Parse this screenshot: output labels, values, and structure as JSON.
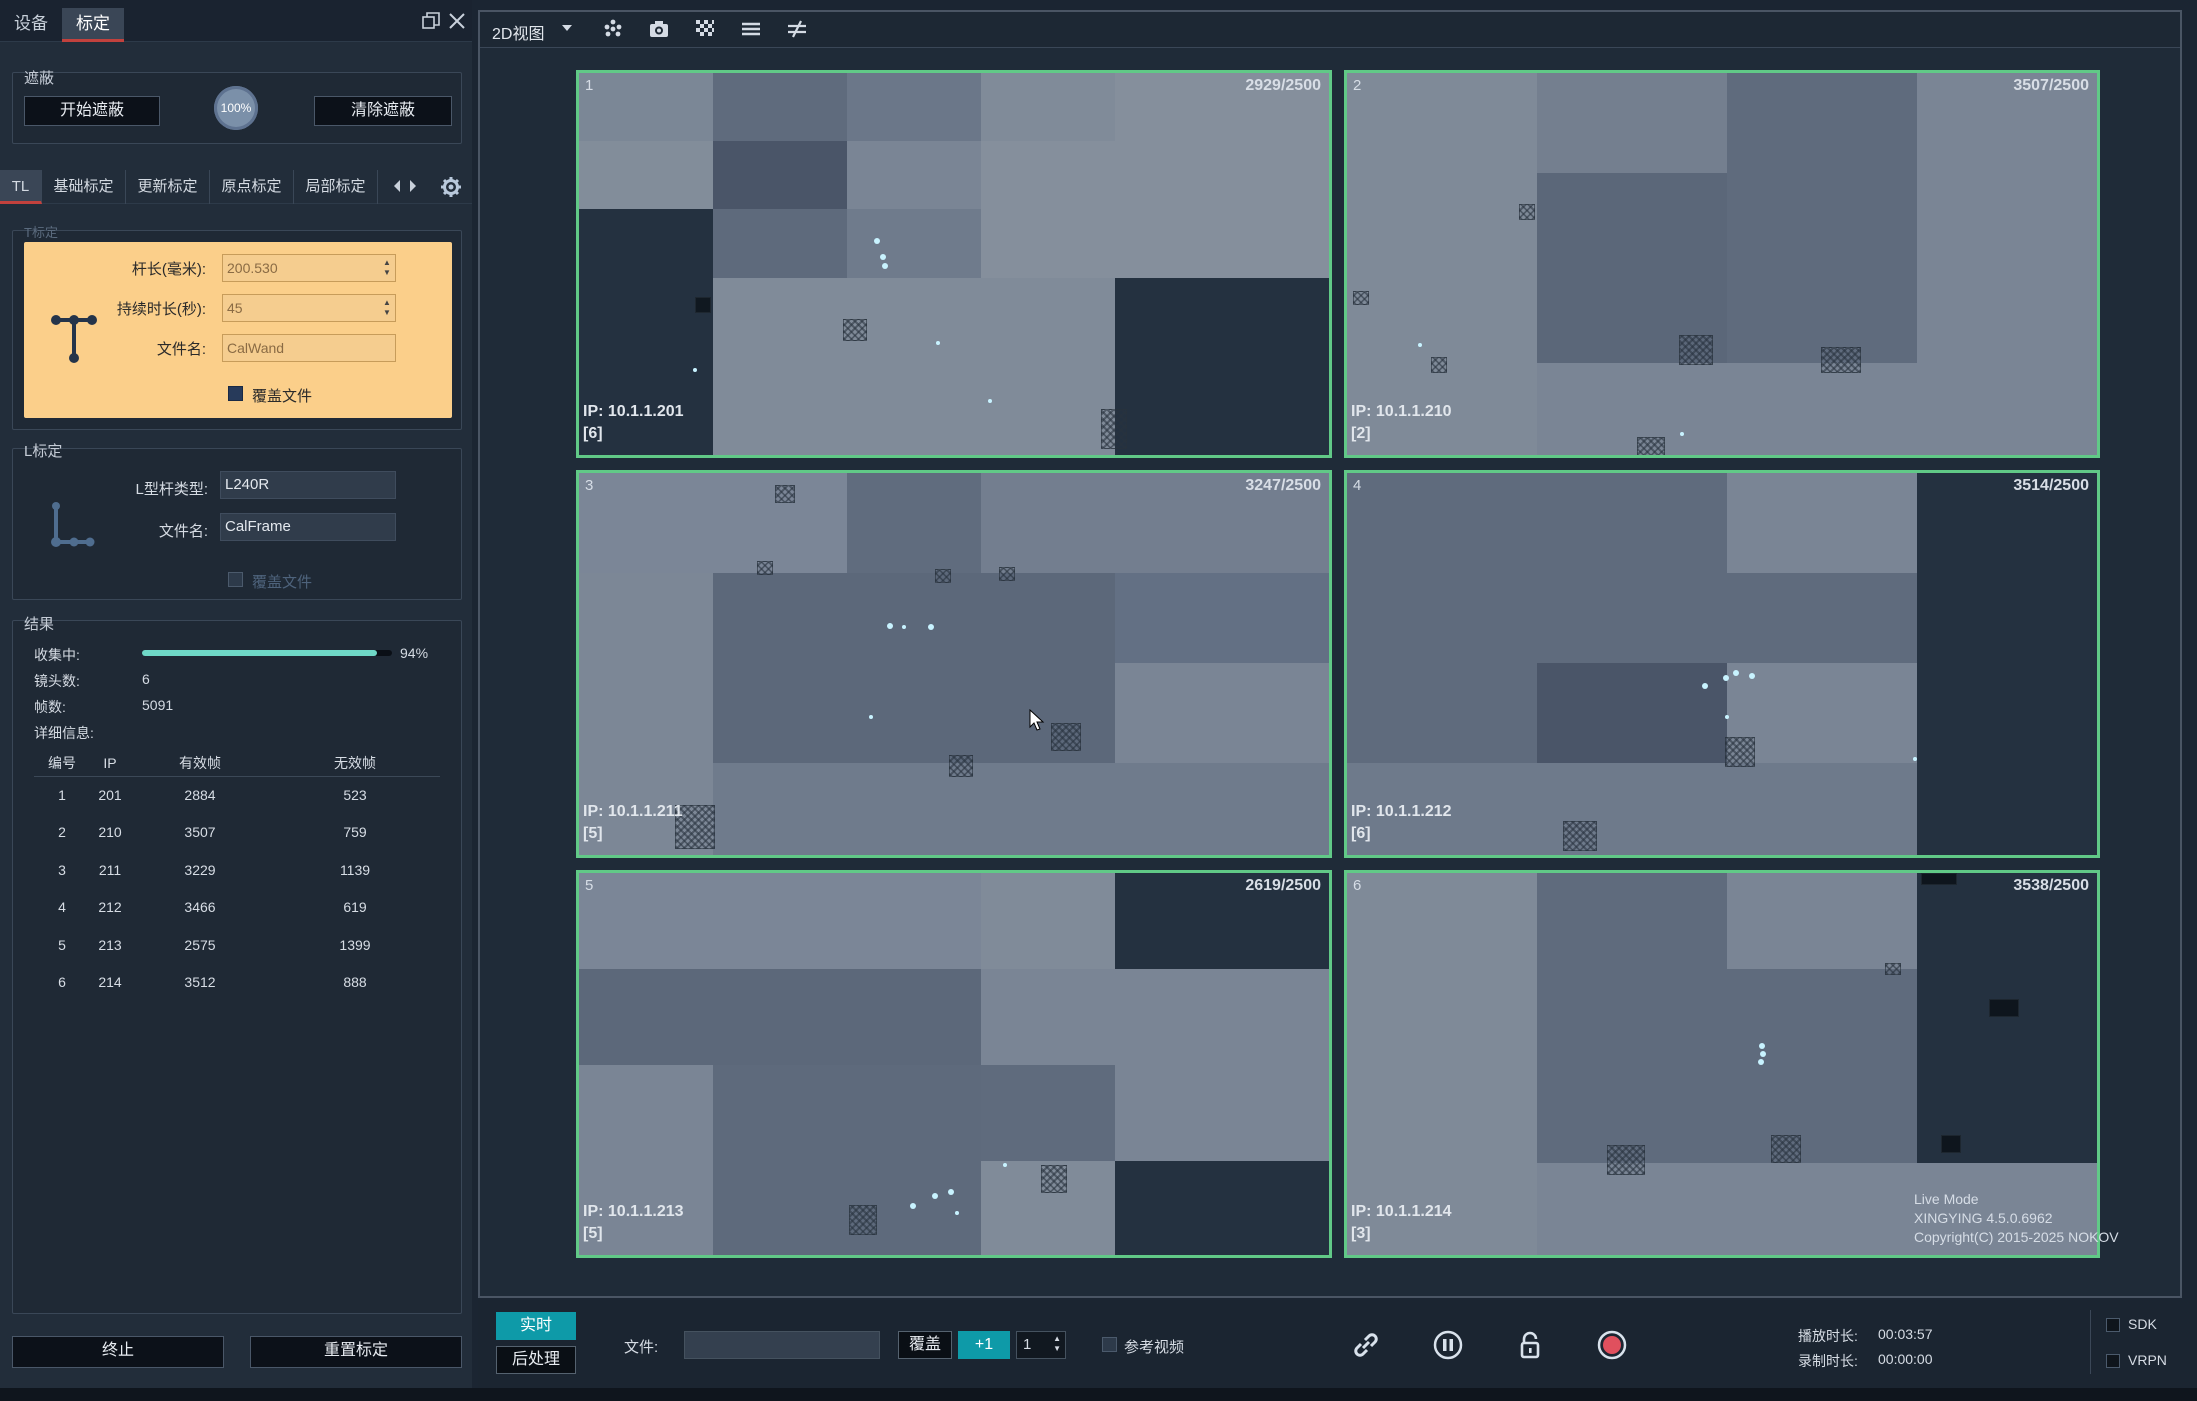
{
  "top_tabs": {
    "devices": "设备",
    "calibration": "标定"
  },
  "mask": {
    "title": "遮蔽",
    "start_label": "开始遮蔽",
    "percent": "100%",
    "clear_label": "清除遮蔽"
  },
  "sub_tabs": [
    "TL",
    "基础标定",
    "更新标定",
    "原点标定",
    "局部标定"
  ],
  "t_cal": {
    "title": "T标定",
    "length_label": "杆长(毫米):",
    "length_value": "200.530",
    "duration_label": "持续时长(秒):",
    "duration_value": "45",
    "filename_label": "文件名:",
    "filename_value": "CalWand",
    "overwrite_label": "覆盖文件",
    "overwrite_checked": true
  },
  "l_cal": {
    "title": "L标定",
    "type_label": "L型杆类型:",
    "type_value": "L240R",
    "filename_label": "文件名:",
    "filename_value": "CalFrame",
    "overwrite_label": "覆盖文件",
    "overwrite_checked": false
  },
  "results": {
    "title": "结果",
    "collecting_label": "收集中:",
    "collecting_percent": "94%",
    "collecting_value": 0.94,
    "lens_label": "镜头数:",
    "lens_value": "6",
    "frames_label": "帧数:",
    "frames_value": "5091",
    "details_label": "详细信息:",
    "columns": [
      "编号",
      "IP",
      "有效帧",
      "无效帧"
    ],
    "rows": [
      [
        "1",
        "201",
        "2884",
        "523"
      ],
      [
        "2",
        "210",
        "3507",
        "759"
      ],
      [
        "3",
        "211",
        "3229",
        "1139"
      ],
      [
        "4",
        "212",
        "3466",
        "619"
      ],
      [
        "5",
        "213",
        "2575",
        "1399"
      ],
      [
        "6",
        "214",
        "3512",
        "888"
      ]
    ]
  },
  "left_footer": {
    "stop_label": "终止",
    "reset_label": "重置标定"
  },
  "toolbar": {
    "view_label": "2D视图"
  },
  "cameras": [
    {
      "num": "1",
      "count": "2929/2500",
      "ip": "IP: 10.1.1.201",
      "sub": "[6]"
    },
    {
      "num": "2",
      "count": "3507/2500",
      "ip": "IP: 10.1.1.210",
      "sub": "[2]"
    },
    {
      "num": "3",
      "count": "3247/2500",
      "ip": "IP: 10.1.1.211",
      "sub": "[5]"
    },
    {
      "num": "4",
      "count": "3514/2500",
      "ip": "IP: 10.1.1.212",
      "sub": "[6]"
    },
    {
      "num": "5",
      "count": "2619/2500",
      "ip": "IP: 10.1.1.213",
      "sub": "[5]"
    },
    {
      "num": "6",
      "count": "3538/2500",
      "ip": "IP: 10.1.1.214",
      "sub": "[3]"
    }
  ],
  "overlay": {
    "mode": "Live Mode",
    "version": "XINGYING 4.5.0.6962",
    "copyright": "Copyright(C) 2015-2025 NOKOV"
  },
  "bottom": {
    "realtime_label": "实时",
    "postprocess_label": "后处理",
    "file_label": "文件:",
    "file_value": "",
    "overwrite_label": "覆盖",
    "plus_label": "+1",
    "step_value": "1",
    "reference_video_label": "参考视频",
    "play_time_label": "播放时长:",
    "play_time_value": "00:03:57",
    "record_time_label": "录制时长:",
    "record_time_value": "00:00:00",
    "sdk_label": "SDK",
    "vrpn_label": "VRPN"
  },
  "colors": {
    "accent_teal": "#0e9aa8",
    "camera_border": "#61c987",
    "tab_active_underline": "#c2413d",
    "record": "#e0505e",
    "calibration_highlight": "#fbcf8a"
  },
  "icons": [
    "dropdown-arrow-icon",
    "points-icon",
    "camera-icon",
    "grid-icon",
    "lines-icon",
    "filter-icon",
    "settings-gear-icon",
    "link-icon",
    "pause-icon",
    "lock-icon",
    "record-icon",
    "restore-icon",
    "close-icon",
    "t-wand-icon",
    "l-frame-icon"
  ]
}
